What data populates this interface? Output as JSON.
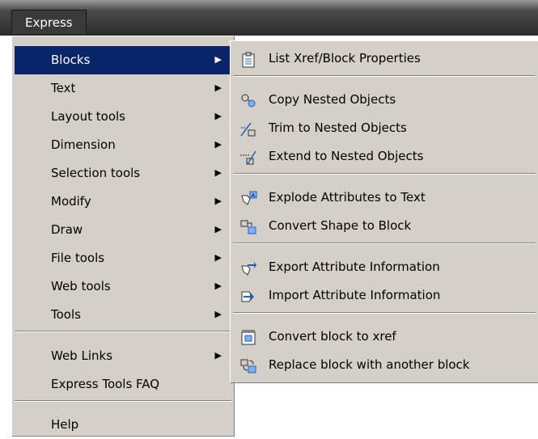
{
  "menubar": {
    "title": "Express"
  },
  "main_menu": {
    "items": [
      {
        "label": "Blocks",
        "has_submenu": true,
        "highlighted": true
      },
      {
        "label": "Text",
        "has_submenu": true
      },
      {
        "label": "Layout tools",
        "has_submenu": true
      },
      {
        "label": "Dimension",
        "has_submenu": true
      },
      {
        "label": "Selection tools",
        "has_submenu": true
      },
      {
        "label": "Modify",
        "has_submenu": true
      },
      {
        "label": "Draw",
        "has_submenu": true
      },
      {
        "label": "File tools",
        "has_submenu": true
      },
      {
        "label": "Web tools",
        "has_submenu": true
      },
      {
        "label": "Tools",
        "has_submenu": true
      },
      {
        "label": "Web Links",
        "has_submenu": true
      },
      {
        "label": "Express Tools FAQ",
        "has_submenu": false
      },
      {
        "label": "Help",
        "has_submenu": false
      }
    ]
  },
  "blocks_submenu": {
    "items": [
      {
        "label": "List Xref/Block Properties",
        "icon": "list-properties-icon"
      },
      {
        "label": "Copy Nested Objects",
        "icon": "copy-nested-icon"
      },
      {
        "label": "Trim to Nested Objects",
        "icon": "trim-nested-icon"
      },
      {
        "label": "Extend to Nested Objects",
        "icon": "extend-nested-icon"
      },
      {
        "label": "Explode Attributes to Text",
        "icon": "explode-attributes-icon"
      },
      {
        "label": "Convert Shape to Block",
        "icon": "convert-shape-icon"
      },
      {
        "label": "Export Attribute Information",
        "icon": "export-attributes-icon"
      },
      {
        "label": "Import Attribute Information",
        "icon": "import-attributes-icon"
      },
      {
        "label": "Convert block to xref",
        "icon": "convert-xref-icon"
      },
      {
        "label": "Replace block with another block",
        "icon": "replace-block-icon"
      }
    ]
  },
  "colors": {
    "menu_bg": "#d4d0c8",
    "highlight_bg": "#0a246a",
    "menubar_bg": "#2b2b2b",
    "icon_blue": "#1f5fbf"
  }
}
